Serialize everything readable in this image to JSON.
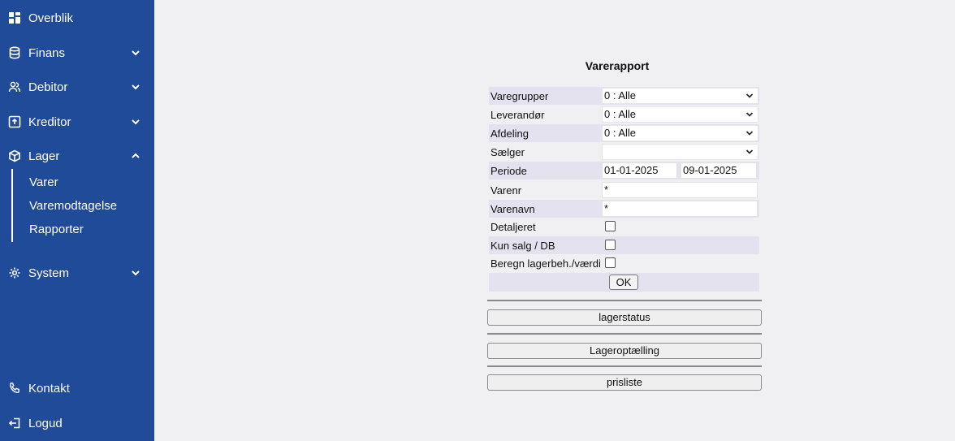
{
  "sidebar": {
    "items": [
      {
        "label": "Overblik",
        "icon": "dashboard-icon"
      },
      {
        "label": "Finans",
        "icon": "database-icon"
      },
      {
        "label": "Debitor",
        "icon": "users-icon"
      },
      {
        "label": "Kreditor",
        "icon": "inbox-icon"
      },
      {
        "label": "Lager",
        "icon": "box-icon"
      },
      {
        "label": "System",
        "icon": "gear-icon"
      },
      {
        "label": "Kontakt",
        "icon": "phone-icon"
      },
      {
        "label": "Logud",
        "icon": "logout-icon"
      }
    ],
    "lager_sub": [
      "Varer",
      "Varemodtagelse",
      "Rapporter"
    ]
  },
  "form": {
    "title": "Varerapport",
    "varegrupper": {
      "label": "Varegrupper",
      "value": "0 : Alle"
    },
    "leverandor": {
      "label": "Leverandør",
      "value": "0 : Alle"
    },
    "afdeling": {
      "label": "Afdeling",
      "value": "0 : Alle"
    },
    "saelger": {
      "label": "Sælger",
      "value": ""
    },
    "periode": {
      "label": "Periode",
      "from": "01-01-2025",
      "to": "09-01-2025"
    },
    "varenr": {
      "label": "Varenr",
      "value": "*"
    },
    "varenavn": {
      "label": "Varenavn",
      "value": "*"
    },
    "detaljeret": {
      "label": "Detaljeret"
    },
    "kun_salg": {
      "label": "Kun salg / DB"
    },
    "beregn": {
      "label": "Beregn lagerbeh./værdi"
    },
    "ok_label": "OK"
  },
  "buttons": {
    "lagerstatus": "lagerstatus",
    "lageroptaelling": "Lageroptælling",
    "prisliste": "prisliste"
  },
  "colors": {
    "sidebar": "#1f4b99",
    "background": "#f0eff1",
    "row_shade": "#e3e2ee"
  }
}
